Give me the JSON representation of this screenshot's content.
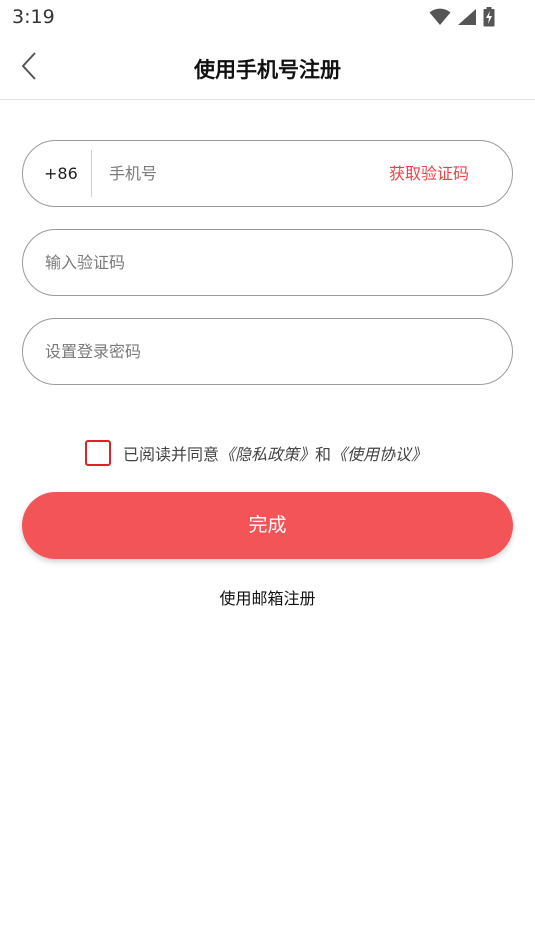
{
  "status_bar": {
    "time": "3:19",
    "icons": [
      "wifi-icon",
      "cell-signal-icon",
      "battery-charging-icon"
    ]
  },
  "nav": {
    "back_icon": "chevron-left-icon",
    "title": "使用手机号注册"
  },
  "form": {
    "country_code": "+86",
    "phone_placeholder": "手机号",
    "get_code_label": "获取验证码",
    "code_placeholder": "输入验证码",
    "password_placeholder": "设置登录密码"
  },
  "agreement": {
    "checked": false,
    "prefix_text": "已阅读并同意",
    "privacy_link": "《隐私政策》",
    "connector": "和",
    "terms_link": "《使用协议》"
  },
  "submit_label": "完成",
  "email_register_label": "使用邮箱注册",
  "colors": {
    "accent": "#f25457",
    "link_red": "#e8444a",
    "checkbox_border": "#e0202a"
  }
}
